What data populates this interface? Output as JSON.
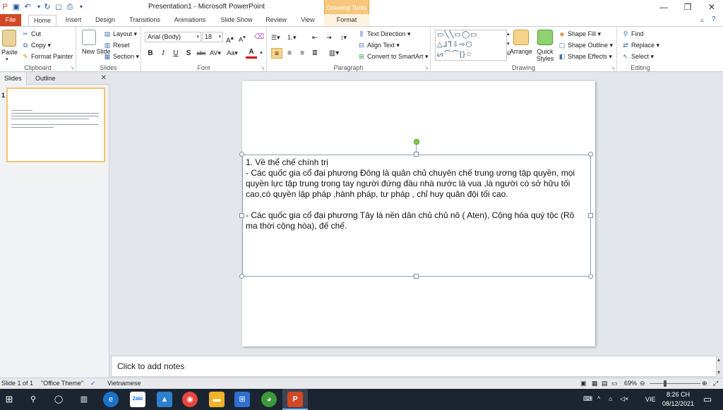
{
  "window": {
    "title": "Presentation1  -  Microsoft PowerPoint",
    "context_tab": "Drawing Tools"
  },
  "tabs": [
    "File",
    "Home",
    "Insert",
    "Design",
    "Transitions",
    "Animations",
    "Slide Show",
    "Review",
    "View",
    "Format"
  ],
  "ribbon": {
    "clipboard": {
      "label": "Clipboard",
      "paste": "Paste",
      "cut": "Cut",
      "copy": "Copy",
      "format_painter": "Format Painter"
    },
    "slides": {
      "label": "Slides",
      "new_slide": "New Slide",
      "layout": "Layout",
      "reset": "Reset",
      "section": "Section"
    },
    "font": {
      "label": "Font",
      "font_name": "Arial (Body)",
      "font_size": "18"
    },
    "paragraph": {
      "label": "Paragraph",
      "text_direction": "Text Direction",
      "align_text": "Align Text",
      "convert_smartart": "Convert to SmartArt"
    },
    "drawing": {
      "label": "Drawing",
      "arrange": "Arrange",
      "quick_styles": "Quick Styles",
      "shape_fill": "Shape Fill",
      "shape_outline": "Shape Outline",
      "shape_effects": "Shape Effects"
    },
    "editing": {
      "label": "Editing",
      "find": "Find",
      "replace": "Replace",
      "select": "Select"
    }
  },
  "panel": {
    "tab_slides": "Slides",
    "tab_outline": "Outline",
    "slide_number": "1"
  },
  "slide": {
    "lines": [
      "1. Về thể chế chính trị",
      "- Các quốc gia cổ đại phương Đông là quân chủ chuyên chế trung ương tập quyền, mọi quyền lực tập trung trong tay người đứng đầu nhà nước là vua  ,là người có sở hữu tối cao,có quyền lập pháp ,hành pháp, tư pháp  , chỉ huy quân đội tối cao.",
      "",
      "- Các quốc gia cổ đại phương Tây là nền dân chủ chủ nô ( Aten), Cộng hòa quý tộc (Rô ma thời cộng hòa), đế chế."
    ]
  },
  "notes": {
    "placeholder": "Click to add notes"
  },
  "status": {
    "slide_info": "Slide 1 of 1",
    "theme": "\"Office Theme\"",
    "language": "Vietnamese",
    "zoom": "69%"
  },
  "taskbar": {
    "lang": "VIE",
    "time": "8:26 CH",
    "date": "08/12/2021",
    "zalo": "Zalo"
  }
}
